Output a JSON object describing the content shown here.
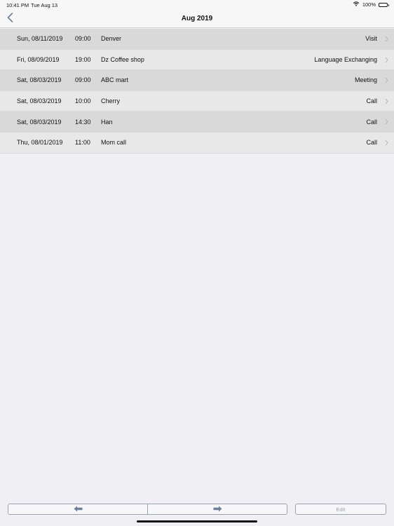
{
  "status_bar": {
    "time": "10:41 PM",
    "date": "Tue Aug 13",
    "battery": "100%",
    "battery_level": 1.0
  },
  "nav": {
    "title": "Aug 2019",
    "back_icon": "chevron-left-icon"
  },
  "rows": [
    {
      "date": "Sun, 08/11/2019",
      "time": "09:00",
      "title": "Denver",
      "type": "Visit"
    },
    {
      "date": "Fri, 08/09/2019",
      "time": "19:00",
      "title": "Dz Coffee shop",
      "type": "Language Exchanging"
    },
    {
      "date": "Sat, 08/03/2019",
      "time": "09:00",
      "title": "ABC mart",
      "type": "Meeting"
    },
    {
      "date": "Sat, 08/03/2019",
      "time": "10:00",
      "title": "Cherry",
      "type": "Call"
    },
    {
      "date": "Sat, 08/03/2019",
      "time": "14:30",
      "title": "Han",
      "type": "Call"
    },
    {
      "date": "Thu, 08/01/2019",
      "time": "11:00",
      "title": "Mom call",
      "type": "Call"
    }
  ],
  "toolbar": {
    "prev_icon": "arrow-left-icon",
    "next_icon": "arrow-right-icon",
    "edit_label": "Edit"
  },
  "colors": {
    "accent": "#6d7f99",
    "row_dark": "#d9d9d9",
    "row_light": "#e8e8e8",
    "background": "#efeff4"
  }
}
